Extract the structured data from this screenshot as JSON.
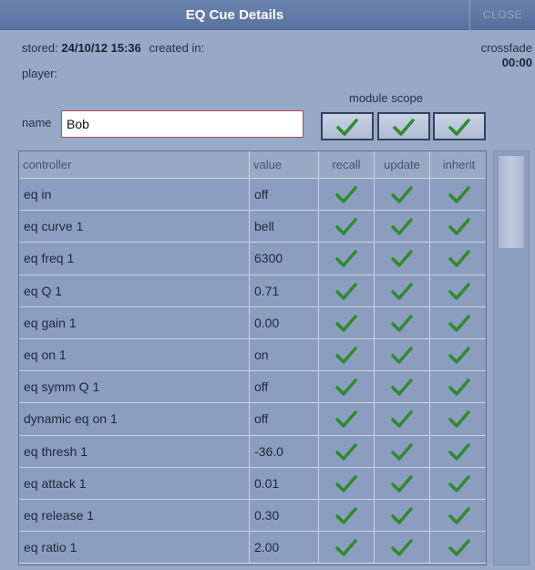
{
  "window": {
    "title": "EQ Cue Details",
    "close_label": "CLOSE"
  },
  "info": {
    "stored_label": "stored:",
    "stored_value": "24/10/12 15:36",
    "created_label": "created in:",
    "player_label": "player:",
    "crossfade_label": "crossfade",
    "crossfade_value": "00:00",
    "name_label": "name",
    "name_value": "Bob",
    "module_scope_label": "module scope"
  },
  "module_scope": [
    {
      "name": "recall",
      "checked": true
    },
    {
      "name": "update",
      "checked": true
    },
    {
      "name": "inherit",
      "checked": true
    }
  ],
  "table": {
    "columns": [
      "controller",
      "value",
      "recall",
      "update",
      "inherit"
    ],
    "rows": [
      {
        "controller": "eq in",
        "value": "off",
        "recall": true,
        "update": true,
        "inherit": true
      },
      {
        "controller": "eq curve 1",
        "value": "bell",
        "recall": true,
        "update": true,
        "inherit": true
      },
      {
        "controller": "eq freq 1",
        "value": "6300",
        "recall": true,
        "update": true,
        "inherit": true
      },
      {
        "controller": "eq Q 1",
        "value": "0.71",
        "recall": true,
        "update": true,
        "inherit": true
      },
      {
        "controller": "eq gain 1",
        "value": "0.00",
        "recall": true,
        "update": true,
        "inherit": true
      },
      {
        "controller": "eq on 1",
        "value": "on",
        "recall": true,
        "update": true,
        "inherit": true
      },
      {
        "controller": "eq symm Q 1",
        "value": "off",
        "recall": true,
        "update": true,
        "inherit": true
      },
      {
        "controller": "dynamic eq on 1",
        "value": "off",
        "recall": true,
        "update": true,
        "inherit": true
      },
      {
        "controller": "eq thresh 1",
        "value": "-36.0",
        "recall": true,
        "update": true,
        "inherit": true
      },
      {
        "controller": "eq attack 1",
        "value": "0.01",
        "recall": true,
        "update": true,
        "inherit": true
      },
      {
        "controller": "eq release 1",
        "value": "0.30",
        "recall": true,
        "update": true,
        "inherit": true
      },
      {
        "controller": "eq ratio 1",
        "value": "2.00",
        "recall": true,
        "update": true,
        "inherit": true
      }
    ]
  },
  "colors": {
    "check": "#2e8b2e",
    "title_bg": "#5f78a6",
    "panel_bg": "#98a9c6"
  },
  "icons": {
    "check": "checkmark-icon"
  }
}
